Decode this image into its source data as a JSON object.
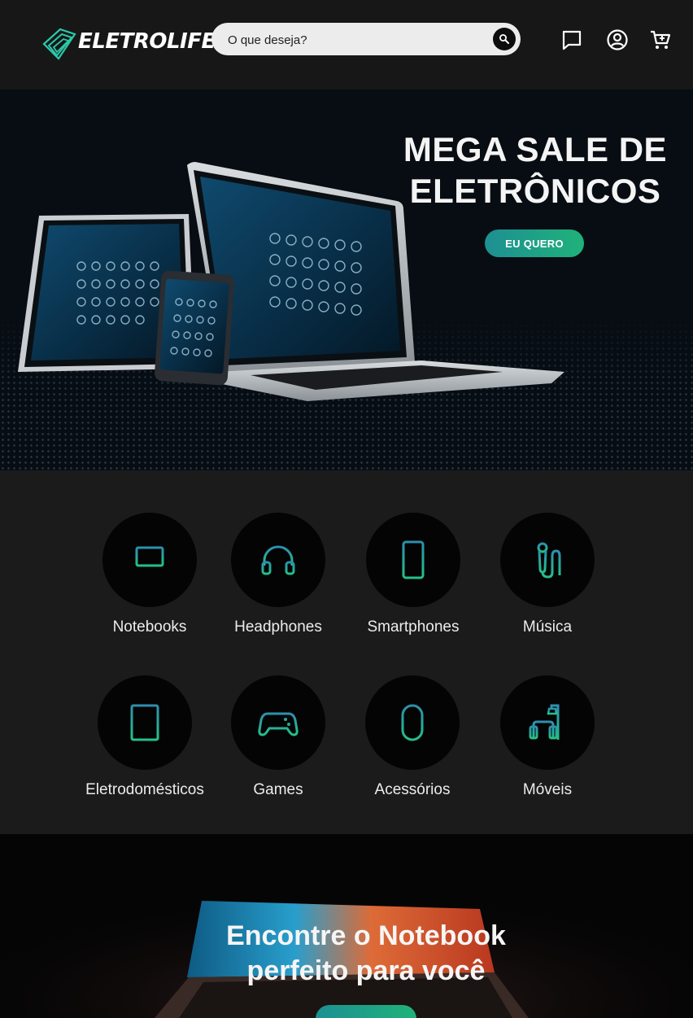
{
  "header": {
    "brand": "ELETROLIFE",
    "search_placeholder": "O que deseja?",
    "icons": [
      "chat-icon",
      "user-icon",
      "cart-icon"
    ]
  },
  "hero": {
    "title": "MEGA SALE DE ELETRÔNICOS",
    "cta": "EU QUERO"
  },
  "categories": [
    {
      "label": "Notebooks",
      "icon": "laptop-icon"
    },
    {
      "label": "Headphones",
      "icon": "headphones-icon"
    },
    {
      "label": "Smartphones",
      "icon": "smartphone-icon"
    },
    {
      "label": "Música",
      "icon": "microphone-icon"
    },
    {
      "label": "Eletrodomésticos",
      "icon": "refrigerator-icon"
    },
    {
      "label": "Games",
      "icon": "gamepad-icon"
    },
    {
      "label": "Acessórios",
      "icon": "mouse-icon"
    },
    {
      "label": "Móveis",
      "icon": "armchair-lamp-icon"
    }
  ],
  "banner": {
    "title": "Encontre o Notebook perfeito para você"
  },
  "colors": {
    "accent_start": "#1e8f92",
    "accent_end": "#1fb27a",
    "background": "#1b1b1c",
    "header": "#171717"
  }
}
